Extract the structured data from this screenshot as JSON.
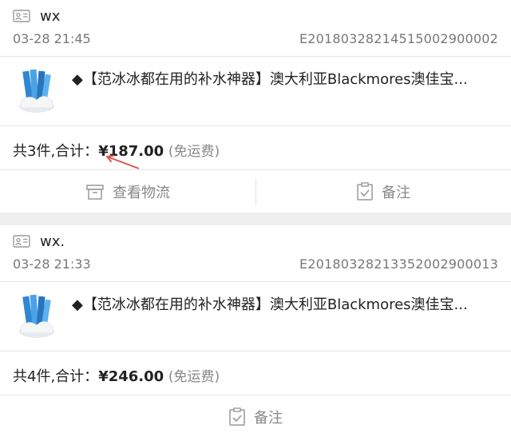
{
  "orders": [
    {
      "buyer": "wx",
      "time": "03-28 21:45",
      "order_no": "E20180328214515002900002",
      "item_title": "◆【范冰冰都在用的补水神器】澳大利亚Blackmores澳佳宝...",
      "summary_prefix": "共3件,合计：",
      "price": "¥187.00",
      "shipping": "(免运费)",
      "actions": [
        "查看物流",
        "备注"
      ]
    },
    {
      "buyer": "wx.",
      "time": "03-28 21:33",
      "order_no": "E20180328213352002900013",
      "item_title": "◆【范冰冰都在用的补水神器】澳大利亚Blackmores澳佳宝...",
      "summary_prefix": "共4件,合计：",
      "price": "¥246.00",
      "shipping": "(免运费)",
      "actions": [
        "备注"
      ]
    }
  ],
  "icons": {
    "buyer": "id-card-icon",
    "logistics": "box-icon",
    "note": "clipboard-check-icon",
    "annotation": "red-arrow-icon"
  },
  "colors": {
    "annotation_arrow": "#d9534f",
    "thumb_blue": "#3a8fd6"
  }
}
